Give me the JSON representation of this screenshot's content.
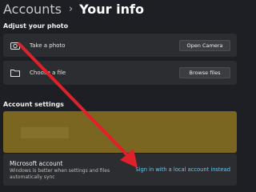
{
  "header": {
    "breadcrumb_parent": "Accounts",
    "separator": "›",
    "breadcrumb_current": "Your info"
  },
  "adjust_photo": {
    "section_label": "Adjust your photo",
    "take_photo": {
      "icon": "camera-icon",
      "label": "Take a photo",
      "button_label": "Open Camera"
    },
    "choose_file": {
      "icon": "folder-icon",
      "label": "Choose a file",
      "button_label": "Browse files"
    }
  },
  "account_settings": {
    "section_label": "Account settings",
    "microsoft_account": {
      "title": "Microsoft account",
      "description": "Windows is better when settings and files automatically sync",
      "link_label": "Sign in with a local account instead"
    }
  },
  "colors": {
    "background": "#1d1f24",
    "card": "#2b2d31",
    "profile_card": "#7a6620",
    "link": "#6cc6f0",
    "annotation_arrow": "#e0202a"
  }
}
